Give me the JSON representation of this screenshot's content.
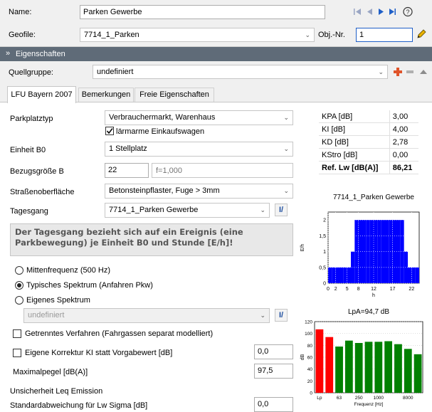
{
  "header": {
    "name_label": "Name:",
    "name_value": "Parken Gewerbe",
    "geofile_label": "Geofile:",
    "geofile_value": "7714_1_Parken",
    "objnr_label": "Obj.-Nr.",
    "objnr_value": "1",
    "help_glyph": "?",
    "edit_icon": "pencil-icon"
  },
  "eigenschaften_bar": {
    "label": "Eigenschaften"
  },
  "quellgruppe": {
    "label": "Quellgruppe:",
    "value": "undefiniert"
  },
  "tabs": [
    "LFU Bayern 2007",
    "Bemerkungen",
    "Freie Eigenschaften"
  ],
  "form": {
    "parkplatztyp_label": "Parkplatztyp",
    "parkplatztyp_value": "Verbrauchermarkt, Warenhaus",
    "laermarme_label": "lärmarme Einkaufswagen",
    "laermarme_checked": true,
    "einheit_label": "Einheit B0",
    "einheit_value": "1 Stellplatz",
    "bezugsgroesse_label": "Bezugsgröße B",
    "bezugsgroesse_value": "22",
    "f_placeholder": "f=1,000",
    "strassen_label": "Straßenoberfläche",
    "strassen_value": "Betonsteinpflaster, Fuge > 3mm",
    "tagesgang_label": "Tagesgang",
    "tagesgang_value": "7714_1_Parken Gewerbe",
    "info_text": "Der Tagesgang bezieht sich auf ein Ereignis (eine Parkbewegung) je Einheit B0 und Stunde [E/h]!",
    "radio_mitten": "Mittenfrequenz (500 Hz)",
    "radio_typisch": "Typisches Spektrum (Anfahren Pkw)",
    "radio_eigenes": "Eigenes Spektrum",
    "eigenes_value": "undefiniert",
    "getrennt_label": "Getrenntes Verfahren (Fahrgassen separat modelliert)",
    "korrektur_label": "Eigene Korrektur KI statt Vorgabewert [dB]",
    "korrektur_value": "0,0",
    "maximal_label": "Maximalpegel [dB(A)]",
    "maximal_value": "97,5",
    "unsicherheit_label": "Unsicherheit Leq Emission",
    "standard_label": "Standardabweichung für Lw Sigma [dB]",
    "standard_value": "0,0"
  },
  "kpa_table": [
    {
      "label": "KPA [dB]",
      "value": "3,00"
    },
    {
      "label": "KI [dB]",
      "value": "4,00"
    },
    {
      "label": "KD [dB]",
      "value": "2,78"
    },
    {
      "label": "KStro [dB]",
      "value": "0,00"
    },
    {
      "label": "Ref. Lw  [dB(A)]",
      "value": "86,21"
    }
  ],
  "chart_data": [
    {
      "type": "area",
      "title": "7714_1_Parken Gewerbe",
      "xlabel": "h",
      "ylabel": "E/h",
      "x_ticks": [
        "0",
        "2",
        "5",
        "8",
        "12",
        "17",
        "22"
      ],
      "y_ticks": [
        "0",
        "0,5",
        "1",
        "1,5",
        "2"
      ],
      "xlim": [
        0,
        24
      ],
      "ylim": [
        0,
        2.25
      ],
      "x": [
        0,
        1,
        2,
        3,
        4,
        5,
        6,
        7,
        8,
        9,
        10,
        11,
        12,
        13,
        14,
        15,
        16,
        17,
        18,
        19,
        20,
        21,
        22,
        23
      ],
      "values": [
        0.5,
        0.5,
        0.5,
        0.5,
        0.5,
        0.5,
        1,
        2,
        2,
        2,
        2,
        2,
        2,
        2,
        2,
        2,
        2,
        2,
        2,
        2,
        1,
        0.5,
        0.5,
        0.5
      ],
      "color": "#0000ff",
      "grid": true
    },
    {
      "type": "bar",
      "title": "LpA=94,7 dB",
      "xlabel": "Frequenz [Hz]",
      "ylabel": "dB",
      "x_ticks": [
        "Lp",
        "63",
        "250",
        "1000",
        "8000"
      ],
      "y_ticks": [
        "0",
        "20",
        "40",
        "60",
        "80",
        "100",
        "120"
      ],
      "ylim": [
        0,
        120
      ],
      "values": [
        107,
        94,
        78,
        88,
        84,
        86,
        86,
        87,
        82,
        74,
        65
      ],
      "colors": [
        "#ff0000",
        "#ff0000",
        "#008000",
        "#008000",
        "#008000",
        "#008000",
        "#008000",
        "#008000",
        "#008000",
        "#008000",
        "#008000"
      ],
      "grid": true
    }
  ]
}
